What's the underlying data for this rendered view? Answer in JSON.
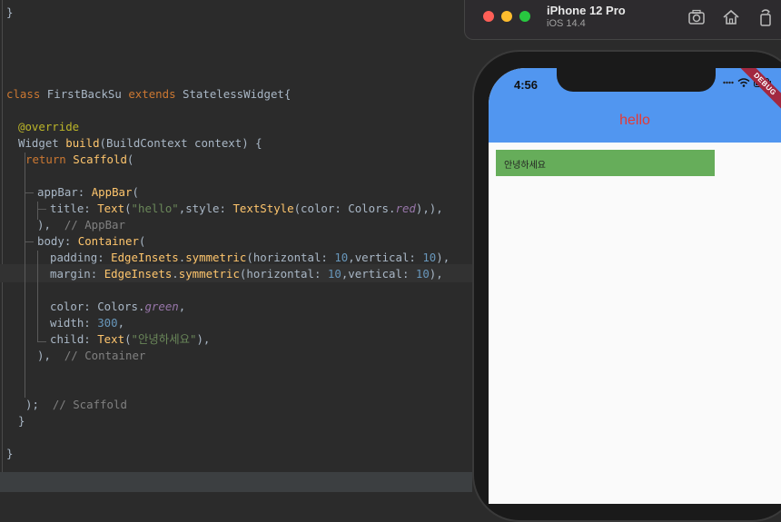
{
  "code": {
    "lines": {
      "close_brace_top": "}",
      "class_kw": "class",
      "class_name": "FirstBackSu",
      "extends_kw": "extends",
      "super_name": "StatelessWidget",
      "class_open": "{",
      "override": "@override",
      "build_type": "Widget",
      "build_fn": "build",
      "build_params": "(BuildContext context) {",
      "return_kw": "return",
      "scaffold": "Scaffold",
      "scaffold_open": "(",
      "appbar_prop": "appBar: ",
      "appbar_cls": "AppBar",
      "appbar_open": "(",
      "title_prop": "title: ",
      "text_cls": "Text",
      "paren": "(",
      "hello_str": "\"hello\"",
      "style_prop": ",style: ",
      "textstyle_cls": "TextStyle",
      "color_prop": "(color: Colors.",
      "red": "red",
      "title_close": "),),",
      "appbar_close": "),",
      "appbar_comment": "// AppBar",
      "body_prop": "body: ",
      "container_cls": "Container",
      "body_open": "(",
      "padding_prop": "padding: ",
      "edgeinsets": "EdgeInsets",
      "dot": ".",
      "symmetric": "symmetric",
      "horizontal": "(horizontal: ",
      "num10": "10",
      "vertical": ",vertical: ",
      "close_comma": "),",
      "margin_prop": "margin: ",
      "color_prop2": "color: Colors.",
      "green": "green",
      "comma": ",",
      "width_prop": "width: ",
      "num300": "300",
      "child_prop": "child: ",
      "korean_str": "\"안녕하세요\"",
      "child_close": "),",
      "container_close": "),",
      "container_comment": "// Container",
      "scaffold_close": ");",
      "scaffold_comment": "// Scaffold",
      "build_close": "}",
      "class_close": "}"
    }
  },
  "simulator": {
    "device_name": "iPhone 12 Pro",
    "os_version": "iOS 14.4",
    "status_time": "4:56",
    "appbar_title": "hello",
    "debug_banner": "DEBUG",
    "container_text": "안녕하세요",
    "colors": {
      "appbar": "#5196f0",
      "title": "#e53935",
      "container": "#66ad5a"
    }
  }
}
